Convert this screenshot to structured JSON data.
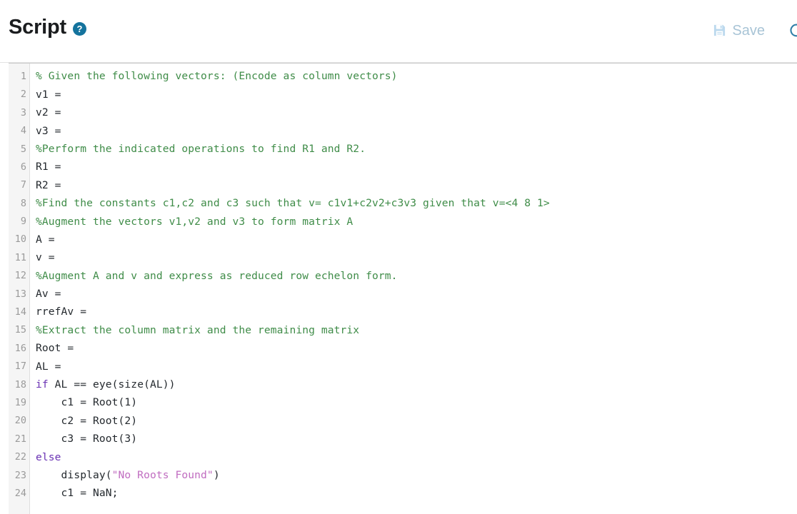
{
  "header": {
    "title": "Script",
    "help_icon_label": "?",
    "help_icon_name": "question-mark-circle-icon",
    "actions": [
      {
        "label": "Save",
        "icon": "floppy-disk-icon"
      },
      {
        "label": "",
        "icon": "refresh-circle-icon"
      }
    ]
  },
  "colors": {
    "accent": "#14739d",
    "comment": "#3f8c48",
    "keyword": "#6a32b4",
    "string": "#c06cc0",
    "code": "#24292e",
    "action_text": "#a8c4d6",
    "gutter_bg": "#f5f5f5",
    "gutter_text": "#9a9a9a"
  },
  "editor": {
    "lines": [
      {
        "n": "1",
        "tokens": [
          {
            "t": "comment",
            "s": "% Given the following vectors: (Encode as column vectors)"
          }
        ]
      },
      {
        "n": "2",
        "tokens": [
          {
            "t": "plain",
            "s": "v1 ="
          }
        ]
      },
      {
        "n": "3",
        "tokens": [
          {
            "t": "plain",
            "s": "v2 ="
          }
        ]
      },
      {
        "n": "4",
        "tokens": [
          {
            "t": "plain",
            "s": "v3 ="
          }
        ]
      },
      {
        "n": "5",
        "tokens": [
          {
            "t": "comment",
            "s": "%Perform the indicated operations to find R1 and R2."
          }
        ]
      },
      {
        "n": "6",
        "tokens": [
          {
            "t": "plain",
            "s": "R1 ="
          }
        ]
      },
      {
        "n": "7",
        "tokens": [
          {
            "t": "plain",
            "s": "R2 ="
          }
        ]
      },
      {
        "n": "8",
        "tokens": [
          {
            "t": "comment",
            "s": "%Find the constants c1,c2 and c3 such that v= c1v1+c2v2+c3v3 given that v=<4 8 1>"
          }
        ]
      },
      {
        "n": "9",
        "tokens": [
          {
            "t": "comment",
            "s": "%Augment the vectors v1,v2 and v3 to form matrix A"
          }
        ]
      },
      {
        "n": "10",
        "tokens": [
          {
            "t": "plain",
            "s": "A ="
          }
        ]
      },
      {
        "n": "11",
        "tokens": [
          {
            "t": "plain",
            "s": "v ="
          }
        ]
      },
      {
        "n": "12",
        "tokens": [
          {
            "t": "comment",
            "s": "%Augment A and v and express as reduced row echelon form."
          }
        ]
      },
      {
        "n": "13",
        "tokens": [
          {
            "t": "plain",
            "s": "Av ="
          }
        ]
      },
      {
        "n": "14",
        "tokens": [
          {
            "t": "plain",
            "s": "rrefAv ="
          }
        ]
      },
      {
        "n": "15",
        "tokens": [
          {
            "t": "comment",
            "s": "%Extract the column matrix and the remaining matrix"
          }
        ]
      },
      {
        "n": "16",
        "tokens": [
          {
            "t": "plain",
            "s": "Root ="
          }
        ]
      },
      {
        "n": "17",
        "tokens": [
          {
            "t": "plain",
            "s": "AL ="
          }
        ]
      },
      {
        "n": "18",
        "tokens": [
          {
            "t": "keyword",
            "s": "if"
          },
          {
            "t": "plain",
            "s": " AL == eye(size(AL))"
          }
        ]
      },
      {
        "n": "19",
        "tokens": [
          {
            "t": "plain",
            "s": "    c1 = Root(1)"
          }
        ]
      },
      {
        "n": "20",
        "tokens": [
          {
            "t": "plain",
            "s": "    c2 = Root(2)"
          }
        ]
      },
      {
        "n": "21",
        "tokens": [
          {
            "t": "plain",
            "s": "    c3 = Root(3)"
          }
        ]
      },
      {
        "n": "22",
        "tokens": [
          {
            "t": "keyword",
            "s": "else"
          }
        ]
      },
      {
        "n": "23",
        "tokens": [
          {
            "t": "plain",
            "s": "    display("
          },
          {
            "t": "string",
            "s": "\"No Roots Found\""
          },
          {
            "t": "plain",
            "s": ")"
          }
        ]
      },
      {
        "n": "24",
        "tokens": [
          {
            "t": "plain",
            "s": "    c1 = NaN;"
          }
        ]
      }
    ]
  }
}
